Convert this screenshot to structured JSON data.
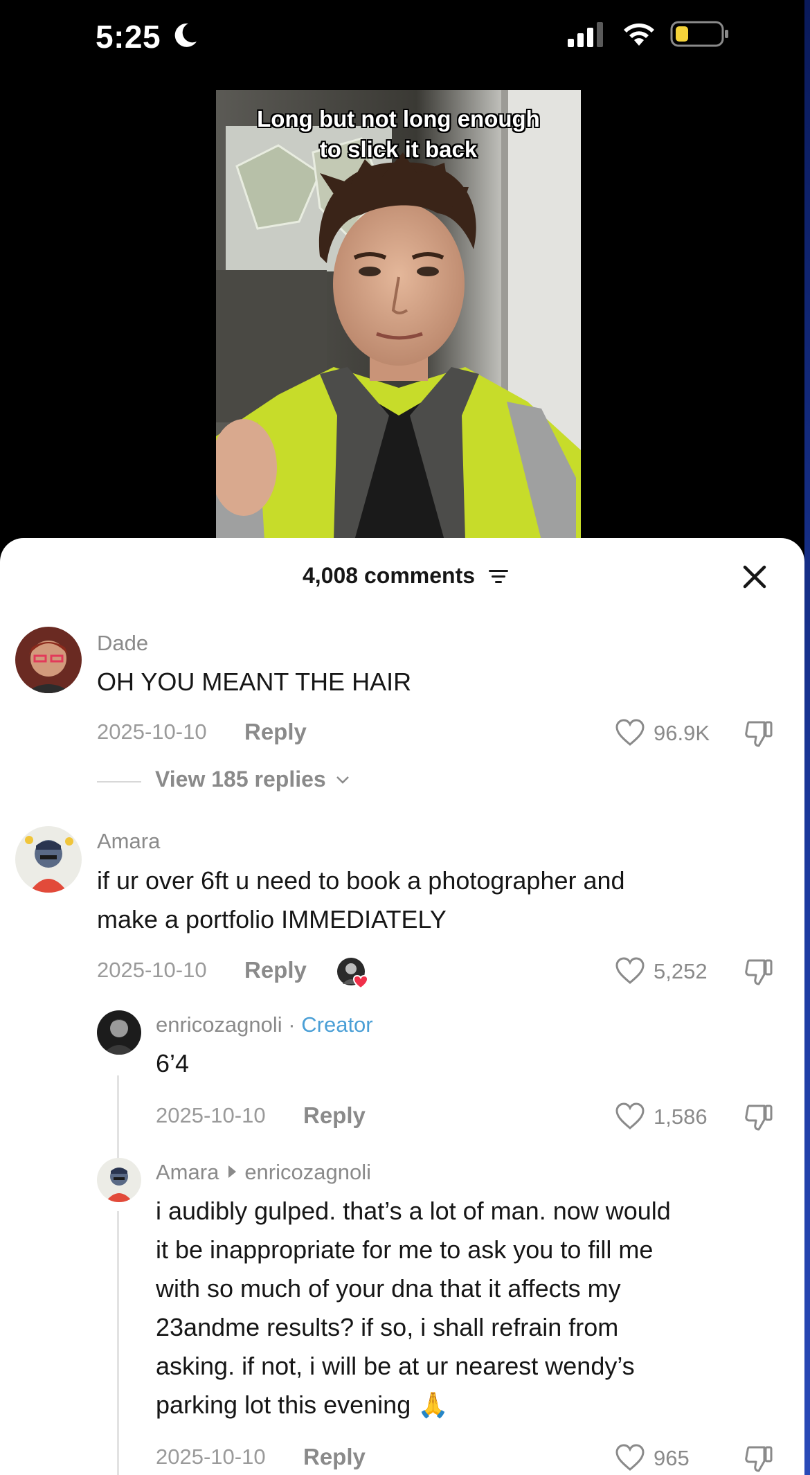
{
  "status_bar": {
    "time": "5:25"
  },
  "video": {
    "caption_line1": "Long but not long enough",
    "caption_line2": "to slick it back"
  },
  "comments_header": {
    "count_label": "4,008 comments"
  },
  "comments": [
    {
      "username": "Dade",
      "text": "OH YOU MEANT THE HAIR",
      "date": "2025-10-10",
      "reply_label": "Reply",
      "likes": "96.9K",
      "view_replies": "View 185 replies"
    },
    {
      "username": "Amara",
      "text_line1": "if ur over 6ft u need to book a photographer and",
      "text_line2": "make a portfolio IMMEDIATELY",
      "date": "2025-10-10",
      "reply_label": "Reply",
      "likes": "5,252",
      "replies": [
        {
          "username": "enricozagnoli",
          "separator": "·",
          "badge": "Creator",
          "text": "6’4",
          "date": "2025-10-10",
          "reply_label": "Reply",
          "likes": "1,586"
        },
        {
          "username": "Amara",
          "reply_to": "enricozagnoli",
          "lines": [
            "i audibly gulped. that’s a lot of man. now would",
            "it be inappropriate for me to ask you to fill me",
            "with so much of your dna that it affects my",
            "23andme results? if so, i shall refrain from",
            "asking. if not, i will be at ur nearest wendy’s",
            "parking lot this evening 🙏"
          ],
          "date": "2025-10-10",
          "reply_label": "Reply",
          "likes": "965"
        }
      ]
    }
  ]
}
